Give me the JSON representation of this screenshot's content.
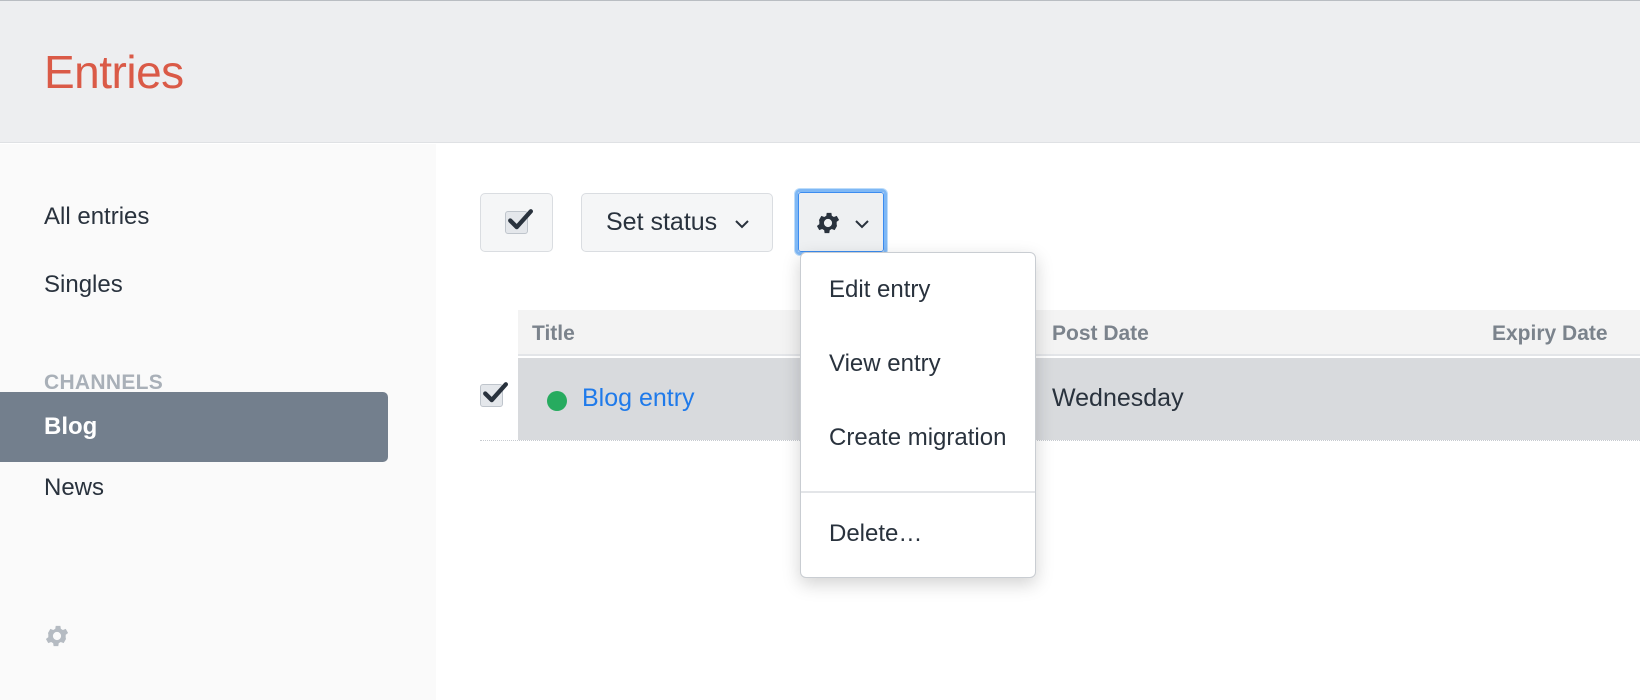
{
  "page": {
    "title": "Entries"
  },
  "sidebar": {
    "items": [
      {
        "label": "All entries"
      },
      {
        "label": "Singles"
      }
    ],
    "channels_heading": "CHANNELS",
    "channels": [
      {
        "label": "Blog",
        "selected": true
      },
      {
        "label": "News",
        "selected": false
      }
    ],
    "settings_icon": "gear-icon"
  },
  "toolbar": {
    "select_all_checked": true,
    "set_status_label": "Set status",
    "actions_icon": "gear-icon"
  },
  "table": {
    "columns": [
      "Title",
      "Post Date",
      "Expiry Date"
    ],
    "rows": [
      {
        "checked": true,
        "status": "live",
        "title": "Blog entry",
        "post_date": "Wednesday",
        "expiry_date": ""
      }
    ]
  },
  "actions_menu": {
    "items": [
      "Edit entry",
      "View entry",
      "Create migration"
    ],
    "danger_items": [
      "Delete…"
    ]
  },
  "colors": {
    "title_accent": "#da5a47",
    "selected_nav_bg": "#737f8d",
    "link": "#1f7aea",
    "status_live": "#27ab5f",
    "focus_ring": "#7fb8f5"
  }
}
